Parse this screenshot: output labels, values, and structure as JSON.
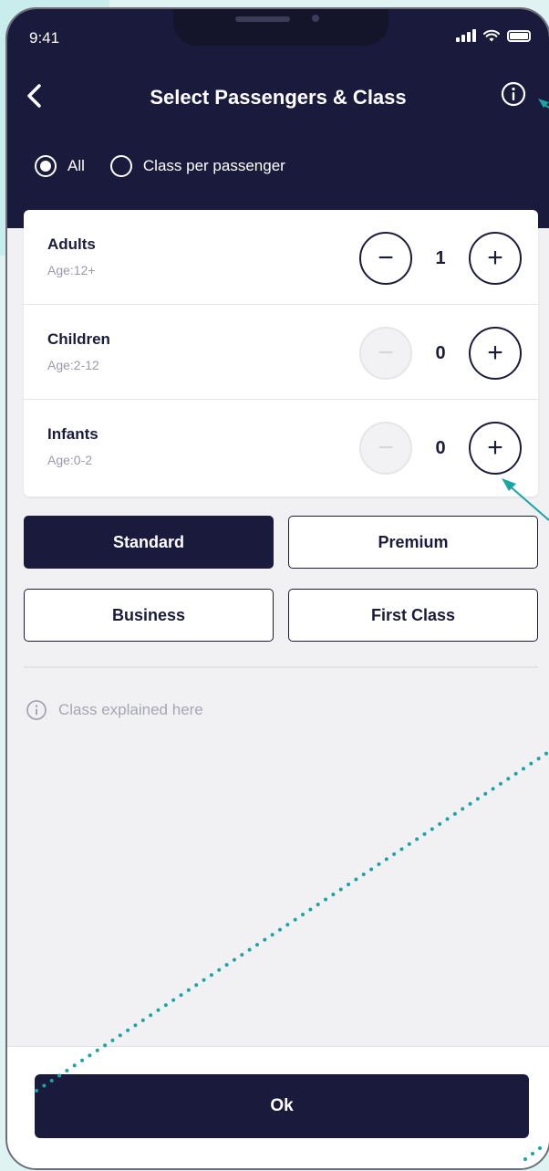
{
  "status_bar": {
    "time": "9:41"
  },
  "header": {
    "title": "Select Passengers & Class"
  },
  "class_mode": {
    "options": [
      {
        "label": "All",
        "selected": true
      },
      {
        "label": "Class per passenger",
        "selected": false
      }
    ]
  },
  "passengers": [
    {
      "name": "Adults",
      "age": "Age:12+",
      "count": "1",
      "minus_enabled": true
    },
    {
      "name": "Children",
      "age": "Age:2-12",
      "count": "0",
      "minus_enabled": false
    },
    {
      "name": "Infants",
      "age": "Age:0-2",
      "count": "0",
      "minus_enabled": false
    }
  ],
  "stepper": {
    "minus_symbol": "−",
    "plus_symbol": "+"
  },
  "classes": [
    {
      "label": "Standard",
      "selected": true
    },
    {
      "label": "Premium",
      "selected": false
    },
    {
      "label": "Business",
      "selected": false
    },
    {
      "label": "First Class",
      "selected": false
    }
  ],
  "explain_text": "Class explained here",
  "ok_label": "Ok",
  "colors": {
    "primary": "#1a1a3c",
    "accent_annotation": "#1aa5a5",
    "background": "#f1f1f4"
  },
  "icons": [
    "back-arrow-icon",
    "info-icon",
    "signal-icon",
    "wifi-icon",
    "battery-icon"
  ]
}
